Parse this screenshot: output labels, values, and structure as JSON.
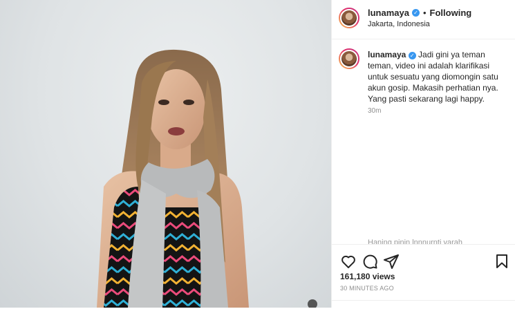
{
  "post": {
    "username": "lunamaya",
    "follow_separator": "•",
    "follow_status": "Following",
    "location": "Jakarta, Indonesia",
    "caption_username": "lunamaya",
    "caption": "Jadi gini ya teman teman, video ini adalah klarifikasi untuk sesuatu yang diomongin satu akun gosip. Makasih perhatian nya. Yang pasti sekarang lagi happy.",
    "caption_time": "30m",
    "next_comment_partial": "Haning pinin lnnnurnti varah",
    "views": "161,180 views",
    "posted_ago": "30 MINUTES AGO"
  },
  "icons": {
    "verified": "verified-badge-icon",
    "like": "heart-icon",
    "comment": "comment-icon",
    "share": "paper-plane-icon",
    "save": "bookmark-icon"
  },
  "colors": {
    "verified_blue": "#3897f0",
    "muted_text": "#8e8e8e"
  }
}
